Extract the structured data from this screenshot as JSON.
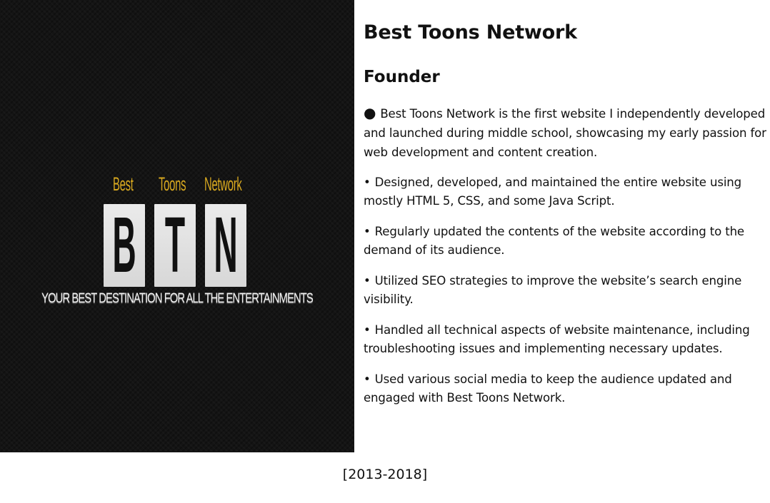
{
  "logo": {
    "words": [
      "Best",
      "Toons",
      "Network"
    ],
    "letters": [
      "B",
      "T",
      "N"
    ],
    "tagline": "YOUR BEST DESTINATION FOR ALL THE ENTERTAINMENTS",
    "word_color": "#d9a91f",
    "panel_color": "#141414"
  },
  "content": {
    "title": "Best Toons Network",
    "role": "Founder",
    "bullets": [
      {
        "mark": "●",
        "text": "Best Toons Network is the first website I independently developed and launched during middle school, showcasing my early passion for web development and content creation."
      },
      {
        "mark": "•",
        "text": "Designed, developed, and maintained the entire website using mostly HTML 5, CSS, and some Java Script."
      },
      {
        "mark": "•",
        "text": "Regularly updated the contents of the website according to the demand of its audience."
      },
      {
        "mark": "•",
        "text": "Utilized SEO strategies to improve the website’s search engine visibility."
      },
      {
        "mark": "•",
        "text": "Handled all technical aspects of website maintenance, including troubleshooting issues and implementing necessary updates."
      },
      {
        "mark": "•",
        "text": "Used various social media to keep the audience updated and engaged with Best Toons Network."
      }
    ]
  },
  "footer": {
    "date_range": "[2013-2018]"
  }
}
